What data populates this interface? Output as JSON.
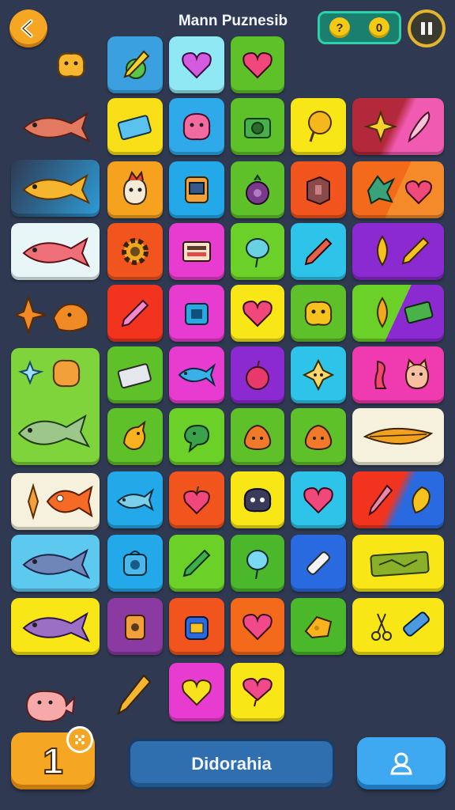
{
  "header": {
    "title": "Mann Puznesib",
    "coins": [
      "?",
      "0"
    ]
  },
  "footer": {
    "level": "1",
    "main_button_label": "Didorahia"
  },
  "colors": {
    "background": "#2f3a52",
    "accent_orange": "#f5a623",
    "button_blue": "#2f6fb0",
    "profile_blue": "#3ea8f0",
    "coin_bar": "#1a7f6f"
  },
  "board": {
    "tiles": [
      {
        "icon": "carrot-icon"
      },
      {
        "icon": "heart-icon"
      },
      {
        "icon": "heart-icon"
      },
      {
        "icon": "battery-icon"
      },
      {
        "icon": "blob-monster-icon"
      },
      {
        "icon": "camera-icon"
      },
      {
        "icon": "bulb-icon"
      },
      {
        "icon": "star-feather-icon"
      },
      {
        "icon": "cat-face-icon"
      },
      {
        "icon": "jar-icon"
      },
      {
        "icon": "eggplant-icon"
      },
      {
        "icon": "crate-icon"
      },
      {
        "icon": "leaf-heart-icon"
      },
      {
        "icon": "gear-icon"
      },
      {
        "icon": "panel-icon"
      },
      {
        "icon": "balloon-icon"
      },
      {
        "icon": "pencil-icon"
      },
      {
        "icon": "drop-pencil-icon"
      },
      {
        "icon": "pencil-icon"
      },
      {
        "icon": "camera-icon"
      },
      {
        "icon": "heart-icon"
      },
      {
        "icon": "blob-icon"
      },
      {
        "icon": "drop-battery-icon"
      },
      {
        "icon": "battery-icon"
      },
      {
        "icon": "fish-icon"
      },
      {
        "icon": "plum-icon"
      },
      {
        "icon": "star-blob-icon"
      },
      {
        "icon": "seahorse-cat-icon"
      },
      {
        "icon": "bird-icon"
      },
      {
        "icon": "lizard-icon"
      },
      {
        "icon": "blob-icon"
      },
      {
        "icon": "blob-icon"
      },
      {
        "icon": "leaf-icon"
      },
      {
        "icon": "whale-icon"
      },
      {
        "icon": "apple-icon"
      },
      {
        "icon": "ghost-icon"
      },
      {
        "icon": "heart-icon"
      },
      {
        "icon": "brush-leaf-icon"
      },
      {
        "icon": "camera-icon"
      },
      {
        "icon": "pencil-icon"
      },
      {
        "icon": "balloon-icon"
      },
      {
        "icon": "bandage-icon"
      },
      {
        "icon": "leaf-card-icon"
      },
      {
        "icon": "jar-icon"
      },
      {
        "icon": "backpack-icon"
      },
      {
        "icon": "heart-icon"
      },
      {
        "icon": "cheese-icon"
      },
      {
        "icon": "scissors-battery-icon"
      },
      {
        "icon": "heart-icon"
      },
      {
        "icon": "heart-icon"
      }
    ]
  },
  "side_items": [
    {
      "icon": "blob-icon"
    },
    {
      "icon": "fish-icon"
    },
    {
      "icon": "fish-icon"
    },
    {
      "icon": "fish-icon"
    },
    {
      "icon": "star-bird-icon"
    },
    {
      "icon": "star-blob-icon"
    },
    {
      "icon": "fish-icon"
    },
    {
      "icon": "pencil-fish-icon"
    },
    {
      "icon": "fish-icon"
    },
    {
      "icon": "fish-icon"
    },
    {
      "icon": "pig-icon"
    },
    {
      "icon": "pencil-icon"
    }
  ]
}
